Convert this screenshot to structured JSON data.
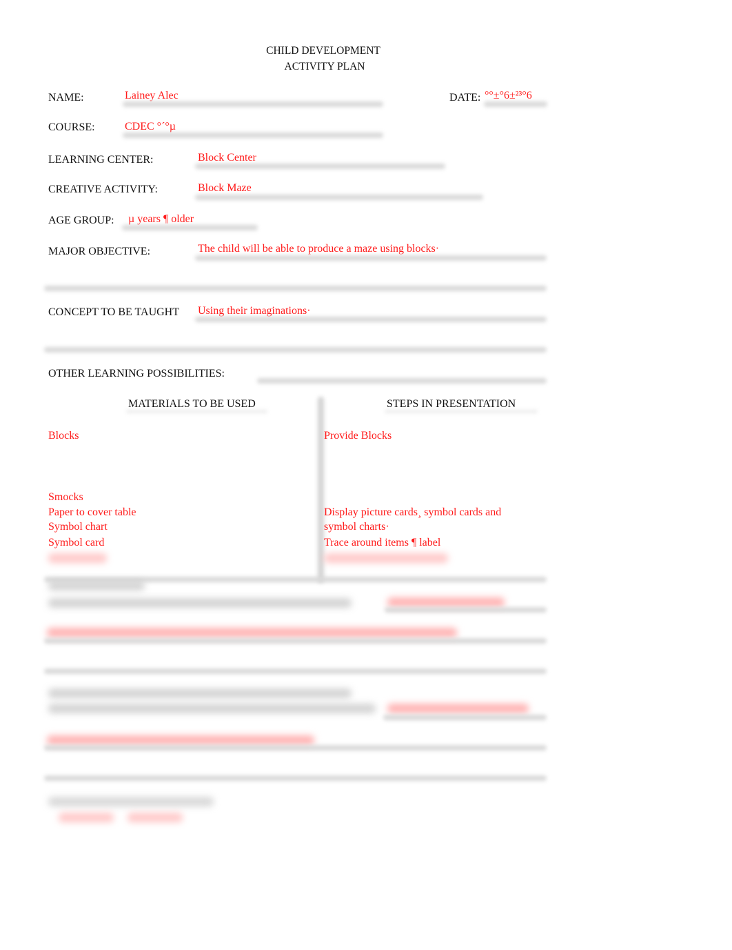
{
  "header": {
    "title_line1": "CHILD DEVELOPMENT",
    "title_line2": "ACTIVITY PLAN"
  },
  "fields": {
    "name": {
      "label": "NAME:",
      "value": "Lainey Alec"
    },
    "date": {
      "label": "DATE:",
      "value": "°°±°6±²³°6"
    },
    "course": {
      "label": "COURSE:",
      "value": "CDEC °´°µ"
    },
    "learning_center": {
      "label": "LEARNING CENTER:",
      "value": "Block Center"
    },
    "creative_activity": {
      "label": "CREATIVE ACTIVITY:",
      "value": "Block Maze"
    },
    "age_group": {
      "label": "AGE GROUP:",
      "value": "µ years ¶ older"
    },
    "major_objective": {
      "label": "MAJOR OBJECTIVE:",
      "value": "The child will be able to produce a maze using blocks·"
    },
    "concept": {
      "label": "CONCEPT TO BE TAUGHT",
      "value": "Using their imaginations·"
    },
    "other_learning": {
      "label": "OTHER LEARNING POSSIBILITIES:",
      "value": ""
    }
  },
  "columns": {
    "materials": {
      "header": "MATERIALS TO BE USED",
      "items": [
        "Blocks",
        "Smocks",
        "Paper to cover table",
        "Symbol chart",
        "Symbol card"
      ]
    },
    "steps": {
      "header": "STEPS IN PRESENTATION",
      "items": [
        "Provide Blocks",
        "Display picture cards¸ symbol cards and",
        "symbol charts·",
        "Trace around items ¶ label"
      ]
    }
  },
  "colors": {
    "entry_text": "#ff1a1a",
    "label_text": "#111111",
    "blur_line": "#d9d9d9"
  }
}
